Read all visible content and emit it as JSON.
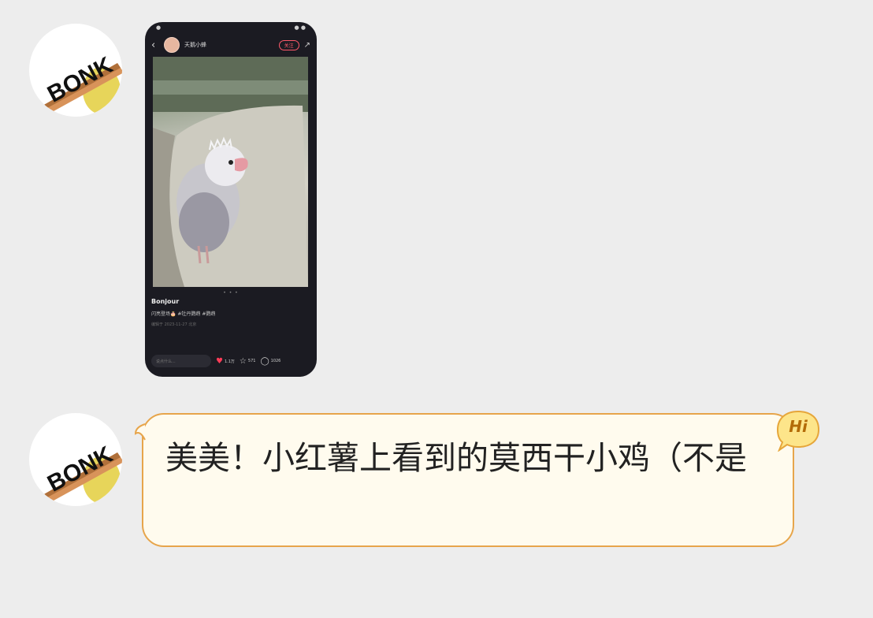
{
  "messages": [
    {
      "sender_avatar": {
        "text": "BONK"
      },
      "type": "image",
      "screenshot": {
        "username": "天鹅小蜂",
        "follow_label": "关注",
        "post_title": "Bonjour",
        "post_tags": "闪亮登场🎂 #牡丹鹦鹉 #鹦鹉",
        "post_meta": "编辑于 2023-11-27 北京",
        "comment_placeholder": "说点什么...",
        "likes": "1.1万",
        "favorites": "571",
        "comments": "1026",
        "pager_dots": "• • •"
      }
    },
    {
      "sender_avatar": {
        "text": "BONK"
      },
      "type": "text",
      "text": "美美！小红薯上看到的莫西干小鸡（不是",
      "badge": "Hi"
    }
  ],
  "colors": {
    "background": "#ededed",
    "bubble_fill": "#fffbee",
    "bubble_border": "#e7a54b",
    "badge_fill": "#fde58a"
  }
}
